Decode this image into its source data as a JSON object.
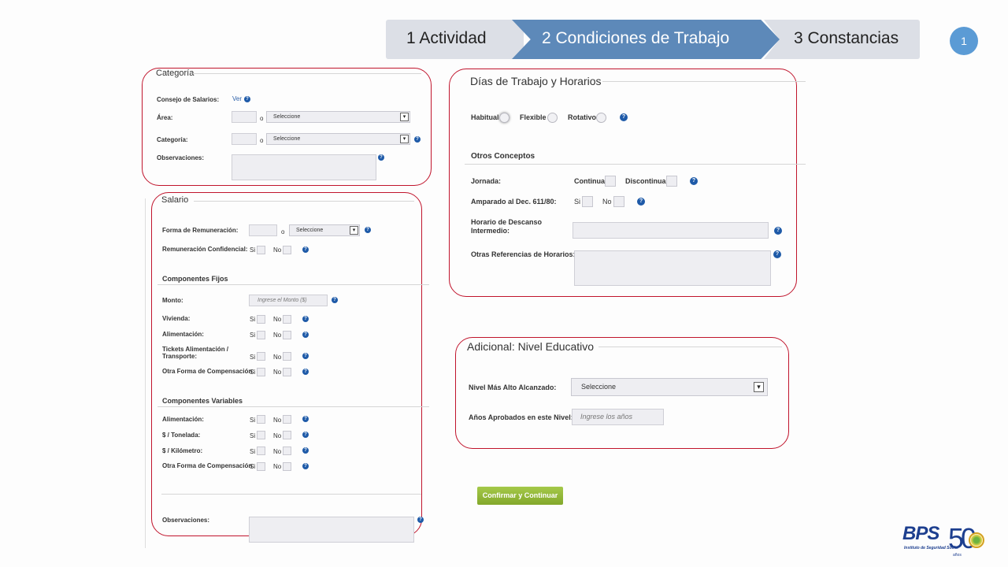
{
  "steps": [
    {
      "label": "1 Actividad"
    },
    {
      "label": "2 Condiciones de Trabajo"
    },
    {
      "label": "3 Constancias"
    }
  ],
  "step_badge": "1",
  "colors": {
    "active_step": "#5d89b9",
    "inactive_step": "#dcdfe6",
    "frame": "#c0142c",
    "help": "#1e5aa8",
    "button": "#94b93a"
  },
  "categoria": {
    "title": "Categoría",
    "consejo_label": "Consejo de Salarios:",
    "consejo_link": "Ver",
    "area_label": "Área:",
    "area_sep": "o",
    "area_select": "Seleccione",
    "categoria_label": "Categoría:",
    "categoria_sep": "o",
    "categoria_select": "Seleccione",
    "obs_label": "Observaciones:"
  },
  "salario": {
    "title": "Salario",
    "forma_label": "Forma de Remuneración:",
    "forma_sep": "o",
    "forma_select": "Seleccione",
    "confidencial_label": "Remuneración Confidencial:",
    "si": "Si",
    "no": "No",
    "fijos_title": "Componentes Fijos",
    "monto_label": "Monto:",
    "monto_placeholder": "Ingrese el Monto ($)",
    "fijos_rows": [
      {
        "label": "Vivienda:"
      },
      {
        "label": "Alimentación:"
      },
      {
        "label1": "Tickets Alimentación /",
        "label2": "Transporte:"
      },
      {
        "label": "Otra Forma de Compensación:"
      }
    ],
    "variables_title": "Componentes Variables",
    "variables_rows": [
      {
        "label": "Alimentación:"
      },
      {
        "label": "$ / Tonelada:"
      },
      {
        "label": "$ / Kilómetro:"
      },
      {
        "label": "Otra Forma de Compensación:"
      }
    ],
    "obs_label": "Observaciones:"
  },
  "dias": {
    "title": "Días de Trabajo y Horarios",
    "habitual": "Habitual",
    "flexible": "Flexible",
    "rotativo": "Rotativo",
    "otros_title": "Otros Conceptos",
    "jornada_label": "Jornada:",
    "continua": "Continua",
    "discontinua": "Discontinua",
    "amparado_label": "Amparado al Dec. 611/80:",
    "si": "Si",
    "no": "No",
    "descanso_label1": "Horario de Descanso",
    "descanso_label2": "Intermedio:",
    "otras_ref_label": "Otras Referencias de Horarios:"
  },
  "educativo": {
    "title": "Adicional: Nivel Educativo",
    "nivel_label": "Nivel Más Alto Alcanzado:",
    "nivel_select": "Seleccione",
    "anios_label": "Años Aprobados en este Nivel:",
    "anios_placeholder": "Ingrese los años"
  },
  "confirm_button": "Confirmar y Continuar",
  "logo": {
    "text": "BPS",
    "subtitle": "Instituto de Seguridad Social",
    "number": "50",
    "small": "años"
  }
}
